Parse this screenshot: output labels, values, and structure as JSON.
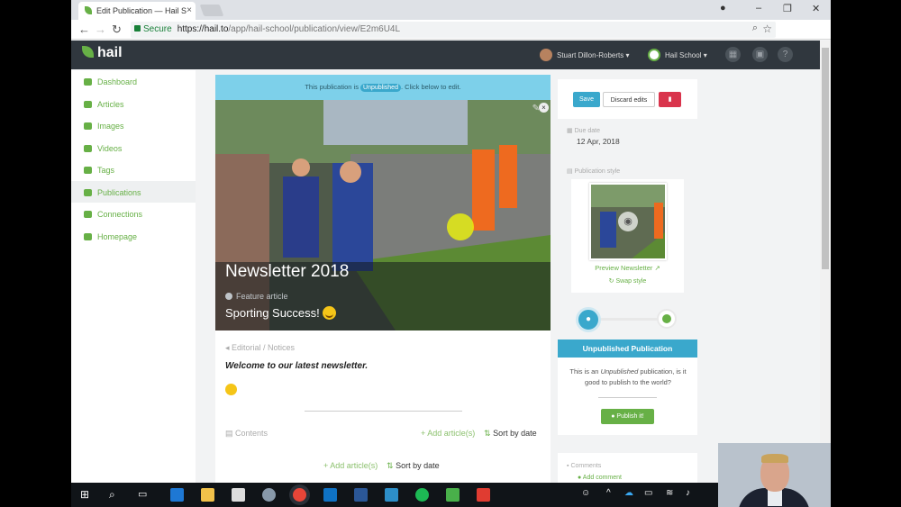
{
  "browser": {
    "tab_title": "Edit Publication — Hail S",
    "url_secure": "Secure",
    "url_host": "https://hail.to",
    "url_path": "/app/hail-school/publication/view/E2m6U4L"
  },
  "app": {
    "logo": "hail",
    "user_name": "Stuart Dillon-Roberts",
    "org_name": "Hail School"
  },
  "sidebar": {
    "items": [
      {
        "label": "Dashboard",
        "icon": "dashboard-icon"
      },
      {
        "label": "Articles",
        "icon": "article-icon"
      },
      {
        "label": "Images",
        "icon": "image-icon"
      },
      {
        "label": "Videos",
        "icon": "video-icon"
      },
      {
        "label": "Tags",
        "icon": "tag-icon"
      },
      {
        "label": "Publications",
        "icon": "book-icon",
        "active": true
      },
      {
        "label": "Connections",
        "icon": "share-icon"
      },
      {
        "label": "Homepage",
        "icon": "home-icon"
      }
    ]
  },
  "main": {
    "banner_prefix": "This publication is",
    "banner_status": "Unpublished",
    "banner_suffix": ". Click below to edit.",
    "title": "Newsletter 2018",
    "feature_label": "Feature article",
    "feature_title": "Sporting Success!",
    "editorial_label": "Editorial / Notices",
    "welcome": "Welcome to our latest newsletter.",
    "contents_label": "Contents",
    "add_article": "+ Add article(s)",
    "sort_by_date": "Sort by date"
  },
  "right": {
    "save": "Save",
    "discard": "Discard edits",
    "due_label": "Due date",
    "due_value": "12 Apr, 2018",
    "style_label": "Publication style",
    "preview": "Preview Newsletter",
    "swap": "Swap style",
    "status_title": "Unpublished Publication",
    "ask_line1": "This is an",
    "ask_italic": "Unpublished",
    "ask_line2": "publication, is it good to publish to the world?",
    "publish": "Publish it!",
    "comments_label": "Comments",
    "add_comment": "Add comment"
  },
  "colors": {
    "accent": "#67b046",
    "info": "#3aa8cc",
    "danger": "#d9344c",
    "topbar": "#30373e"
  }
}
